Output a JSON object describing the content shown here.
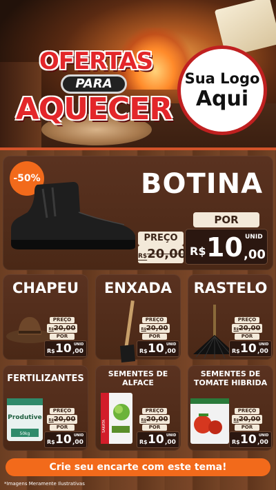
{
  "header": {
    "title_line1": "OFERTAS",
    "title_line2": "PARA",
    "title_line3": "AQUECER",
    "logo_line1": "Sua Logo",
    "logo_line2": "Aqui"
  },
  "featured": {
    "discount_badge": "-50%",
    "name": "BOTINA",
    "preco_label": "PREÇO",
    "por_label": "POR",
    "old_currency": "R$",
    "old_price": "20,00",
    "new_currency": "R$",
    "new_integer": "10",
    "new_decimal": ",00",
    "unit": "UNID"
  },
  "products": [
    {
      "name": "CHAPEU",
      "preco_label": "PREÇO",
      "old_currency": "R$",
      "old_price": "20,00",
      "por_label": "POR",
      "new_currency": "R$",
      "new_integer": "10",
      "new_decimal": ",00",
      "unit": "UNID"
    },
    {
      "name": "ENXADA",
      "preco_label": "PREÇO",
      "old_currency": "R$",
      "old_price": "20,00",
      "por_label": "POR",
      "new_currency": "R$",
      "new_integer": "10",
      "new_decimal": ",00",
      "unit": "UNID"
    },
    {
      "name": "RASTELO",
      "preco_label": "PREÇO",
      "old_currency": "R$",
      "old_price": "20,00",
      "por_label": "POR",
      "new_currency": "R$",
      "new_integer": "10",
      "new_decimal": ",00",
      "unit": "UNID"
    },
    {
      "name": "FERTILIZANTES",
      "preco_label": "PREÇO",
      "old_currency": "R$",
      "old_price": "20,00",
      "por_label": "POR",
      "new_currency": "R$",
      "new_integer": "10",
      "new_decimal": ",00",
      "unit": "UNID",
      "package_brand": "Produtive",
      "package_weight": "50kg"
    },
    {
      "name": "SEMENTES DE ALFACE",
      "preco_label": "PREÇO",
      "old_currency": "R$",
      "old_price": "20,00",
      "por_label": "POR",
      "new_currency": "R$",
      "new_integer": "10",
      "new_decimal": ",00",
      "unit": "UNID",
      "package_brand": "SAKATA"
    },
    {
      "name": "SEMENTES DE TOMATE HIBRIDA",
      "preco_label": "PREÇO",
      "old_currency": "R$",
      "old_price": "20,00",
      "por_label": "POR",
      "new_currency": "R$",
      "new_integer": "10",
      "new_decimal": ",00",
      "unit": "UNID"
    }
  ],
  "cta_label": "Crie seu encarte com este tema!",
  "disclaimer": "*Imagens Meramente Ilustrativas",
  "colors": {
    "accent_orange": "#f26a1b",
    "title_red": "#e3262a",
    "price_dark": "#2b1710",
    "tag_cream": "#f3e9d9"
  }
}
